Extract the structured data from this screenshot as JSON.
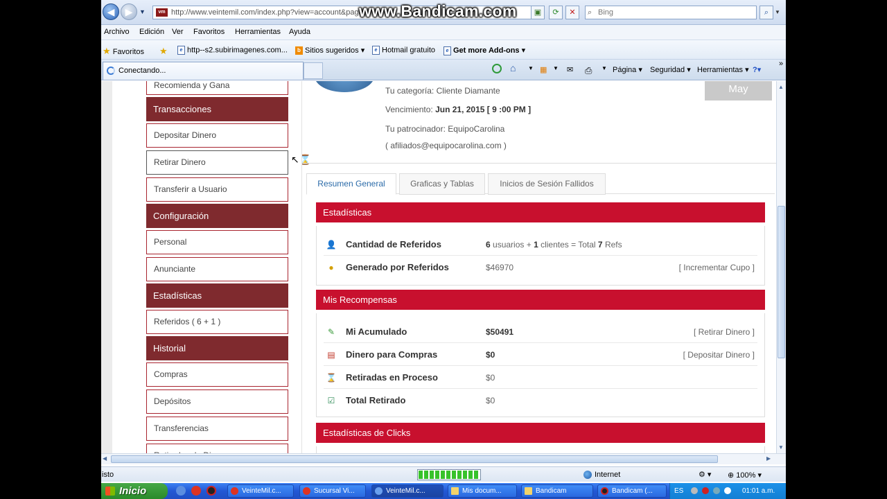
{
  "browser": {
    "url": "http://www.veintemil.com/index.php?view=account&page",
    "site_favicon": "vm",
    "watermark": "www.Bandicam.com",
    "search_placeholder": "Bing",
    "menu": [
      "Archivo",
      "Edición",
      "Ver",
      "Favoritos",
      "Herramientas",
      "Ayuda"
    ],
    "favorites": {
      "label": "Favoritos",
      "items": [
        "http--s2.subirimagenes.com...",
        "Sitios sugeridos",
        "Hotmail gratuito",
        "Get more Add-ons"
      ]
    },
    "tab_title": "Conectando...",
    "commands": [
      "Página",
      "Seguridad",
      "Herramientas"
    ]
  },
  "sidebar": {
    "partial_top": "Recomienda y Gana",
    "sections": [
      {
        "head": "Transacciones",
        "items": [
          "Depositar Dinero",
          "Retirar Dinero",
          "Transferir a Usuario"
        ]
      },
      {
        "head": "Configuración",
        "items": [
          "Personal",
          "Anunciante"
        ]
      },
      {
        "head": "Estadísticas",
        "items": [
          "Referidos ( 6 + 1 )"
        ]
      },
      {
        "head": "Historial",
        "items": [
          "Compras",
          "Depósitos",
          "Transferencias",
          "Retiradas de Dinero"
        ]
      }
    ]
  },
  "account": {
    "category_label": "Tu categoría:",
    "category_value": "Cliente Diamante",
    "expiry_label": "Vencimiento:",
    "expiry_value": "Jun 21, 2015 [ 9 :00 PM ]",
    "sponsor_label": "Tu patrocinador:",
    "sponsor_value": "EquipoCarolina",
    "sponsor_email": "( afiliados@equipocarolina.com )",
    "month_badge": "May"
  },
  "tabs": [
    "Resumen General",
    "Graficas y Tablas",
    "Inicios de Sesión Fallidos"
  ],
  "panels": {
    "stats": {
      "title": "Estadísticas",
      "referrals_label": "Cantidad de Referidos",
      "referrals_users": "6",
      "referrals_users_text": " usuarios + ",
      "referrals_clients": "1",
      "referrals_clients_text": " clientes = Total ",
      "referrals_total": "7",
      "referrals_total_text": " Refs",
      "generated_label": "Generado por Referidos",
      "generated_value": "$46970",
      "generated_link": "[ Incrementar Cupo ]"
    },
    "rewards": {
      "title": "Mis Recompensas",
      "rows": [
        {
          "label": "Mi Acumulado",
          "value": "$50491",
          "link": "[ Retirar Dinero ]",
          "icon": "money-icon"
        },
        {
          "label": "Dinero para Compras",
          "value": "$0",
          "link": "[ Depositar Dinero ]",
          "icon": "cart-icon"
        },
        {
          "label": "Retiradas en Proceso",
          "value": "$0",
          "link": "",
          "icon": "hourglass-icon"
        },
        {
          "label": "Total Retirado",
          "value": "$0",
          "link": "",
          "icon": "check-icon"
        }
      ]
    },
    "clicks": {
      "title": "Estadísticas de Clicks"
    }
  },
  "status": {
    "text": "isto",
    "zone": "Internet",
    "zoom": "100%"
  },
  "taskbar": {
    "start": "Inicio",
    "buttons": [
      "VeinteMil.c...",
      "Sucursal Vi...",
      "VeinteMil.c...",
      "Mis docum...",
      "Bandicam",
      "Bandicam (..."
    ],
    "lang": "ES",
    "clock": "01:01 a.m."
  },
  "colors": {
    "panel_red": "#c8102e",
    "sidebar_head": "#7f2a2e",
    "tab_active": "#2a6aa8"
  }
}
